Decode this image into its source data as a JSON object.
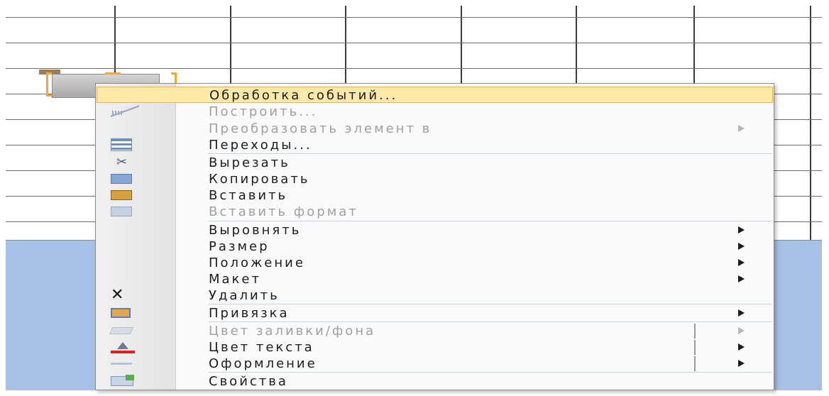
{
  "context_menu": {
    "items": [
      {
        "label": "Обработка событий...",
        "icon": "",
        "disabled": false,
        "submenu": false,
        "highlighted": true
      },
      {
        "label": "Построить...",
        "icon": "build-icon",
        "disabled": true,
        "submenu": false
      },
      {
        "label": "Преобразовать элемент в",
        "icon": "",
        "disabled": true,
        "submenu": true
      },
      {
        "label": "Переходы...",
        "icon": "navigation-icon",
        "disabled": false,
        "submenu": false
      },
      {
        "label": "Вырезать",
        "icon": "scissors-icon",
        "disabled": false,
        "submenu": false
      },
      {
        "label": "Копировать",
        "icon": "copy-icon",
        "disabled": false,
        "submenu": false
      },
      {
        "label": "Вставить",
        "icon": "paste-icon",
        "disabled": false,
        "submenu": false
      },
      {
        "label": "Вставить формат",
        "icon": "paste-format-icon",
        "disabled": true,
        "submenu": false
      },
      {
        "label": "Выровнять",
        "icon": "",
        "disabled": false,
        "submenu": true
      },
      {
        "label": "Размер",
        "icon": "",
        "disabled": false,
        "submenu": true
      },
      {
        "label": "Положение",
        "icon": "",
        "disabled": false,
        "submenu": true
      },
      {
        "label": "Макет",
        "icon": "",
        "disabled": false,
        "submenu": true
      },
      {
        "label": "Удалить",
        "icon": "delete-icon",
        "disabled": false,
        "submenu": false
      },
      {
        "label": "Привязка",
        "icon": "anchoring-icon",
        "disabled": false,
        "submenu": true
      },
      {
        "label": "Цвет заливки/фона",
        "icon": "fill-color-icon",
        "disabled": true,
        "submenu": true
      },
      {
        "label": "Цвет текста",
        "icon": "font-color-icon",
        "disabled": false,
        "submenu": true
      },
      {
        "label": "Оформление",
        "icon": "format-icon",
        "disabled": false,
        "submenu": true
      },
      {
        "label": "Свойства",
        "icon": "properties-icon",
        "disabled": false,
        "submenu": false
      }
    ]
  },
  "colors": {
    "highlight_background": "#ffe9a8",
    "highlight_border": "#f0b04c",
    "design_background": "#a7c1e6",
    "selection_handles": "#f0a838"
  }
}
